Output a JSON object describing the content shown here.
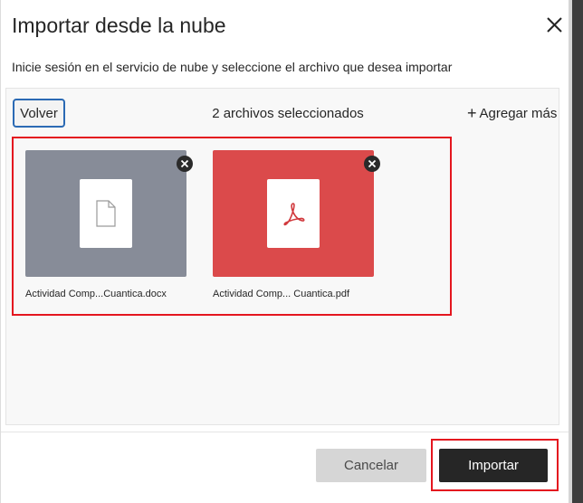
{
  "dialog": {
    "title": "Importar desde la nube",
    "subtitle": "Inicie sesión en el servicio de nube y seleccione el archivo que desea importar",
    "close_icon": "close-icon"
  },
  "toolbar": {
    "back_label": "Volver",
    "selected_count": "2 archivos seleccionados",
    "add_more_label": "Agregar más",
    "add_more_icon": "plus-icon"
  },
  "files": [
    {
      "name": "Actividad Comp...Cuantica.docx",
      "type": "docx",
      "thumb_color": "#878c98",
      "icon": "document-icon",
      "remove_icon": "remove-icon"
    },
    {
      "name": "Actividad Comp... Cuantica.pdf",
      "type": "pdf",
      "thumb_color": "#db4a4b",
      "icon": "pdf-icon",
      "remove_icon": "remove-icon"
    }
  ],
  "footer": {
    "cancel_label": "Cancelar",
    "import_label": "Importar"
  },
  "colors": {
    "highlight": "#e4161f",
    "primary_button": "#262626",
    "focus_ring": "#2b6ab4"
  }
}
